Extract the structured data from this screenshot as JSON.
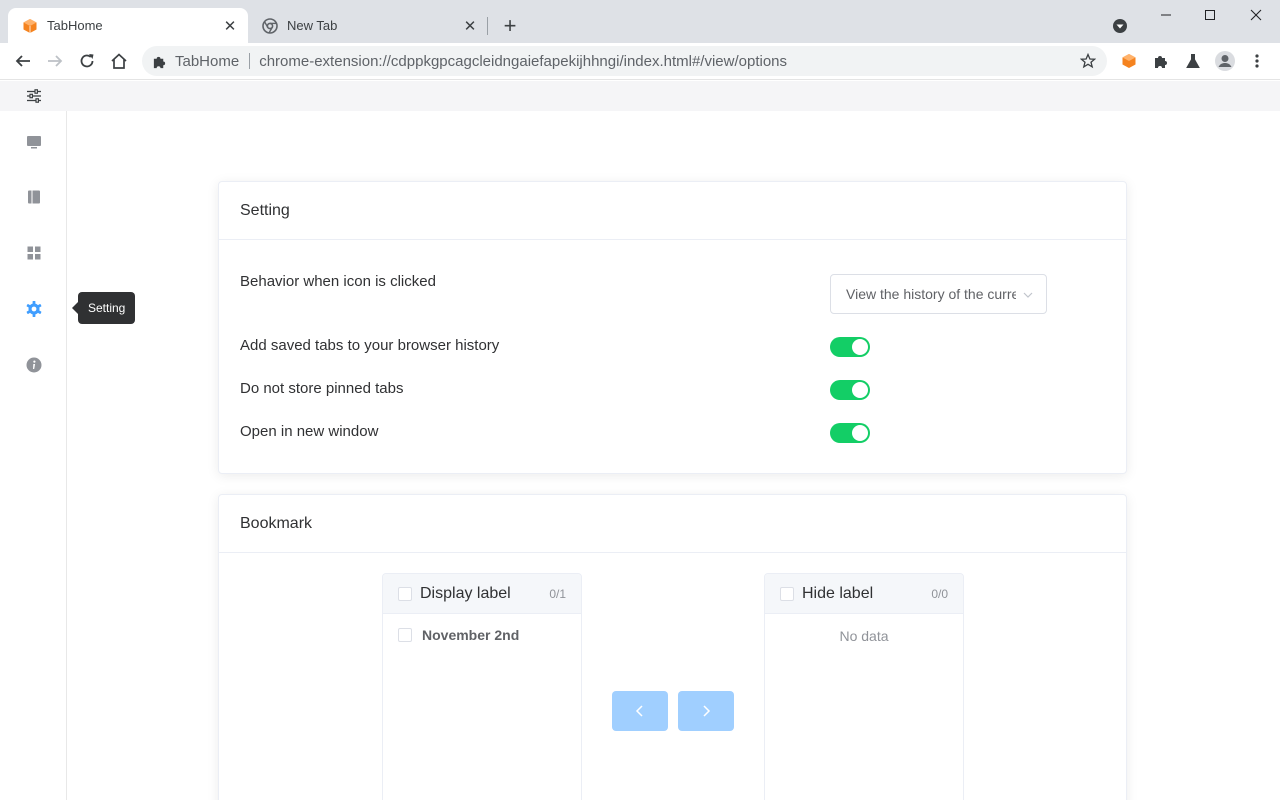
{
  "browser": {
    "tabs": [
      {
        "title": "TabHome",
        "active": true
      },
      {
        "title": "New Tab",
        "active": false
      }
    ],
    "address": {
      "site": "TabHome",
      "url": "chrome-extension://cdppkgpcagcleidngaiefapekijhhngi/index.html#/view/options"
    }
  },
  "sidebar": {
    "items": [
      {
        "icon": "monitor-icon"
      },
      {
        "icon": "book-icon"
      },
      {
        "icon": "grid-icon"
      },
      {
        "icon": "gear-icon",
        "active": true
      },
      {
        "icon": "info-icon"
      }
    ],
    "tooltip": "Setting"
  },
  "setting": {
    "title": "Setting",
    "behavior_label": "Behavior when icon is clicked",
    "behavior_value": "View the history of the current window",
    "toggles": [
      {
        "label": "Add saved tabs to your browser history",
        "on": true
      },
      {
        "label": "Do not store pinned tabs",
        "on": true
      },
      {
        "label": "Open in new window",
        "on": true
      }
    ]
  },
  "bookmark": {
    "title": "Bookmark",
    "left_panel": {
      "label": "Display label",
      "count": "0/1",
      "items": [
        "November 2nd"
      ]
    },
    "right_panel": {
      "label": "Hide label",
      "count": "0/0",
      "empty": "No data"
    }
  },
  "colors": {
    "switch_on": "#13ce66",
    "accent": "#409eff",
    "button_disabled": "#a0cfff"
  }
}
